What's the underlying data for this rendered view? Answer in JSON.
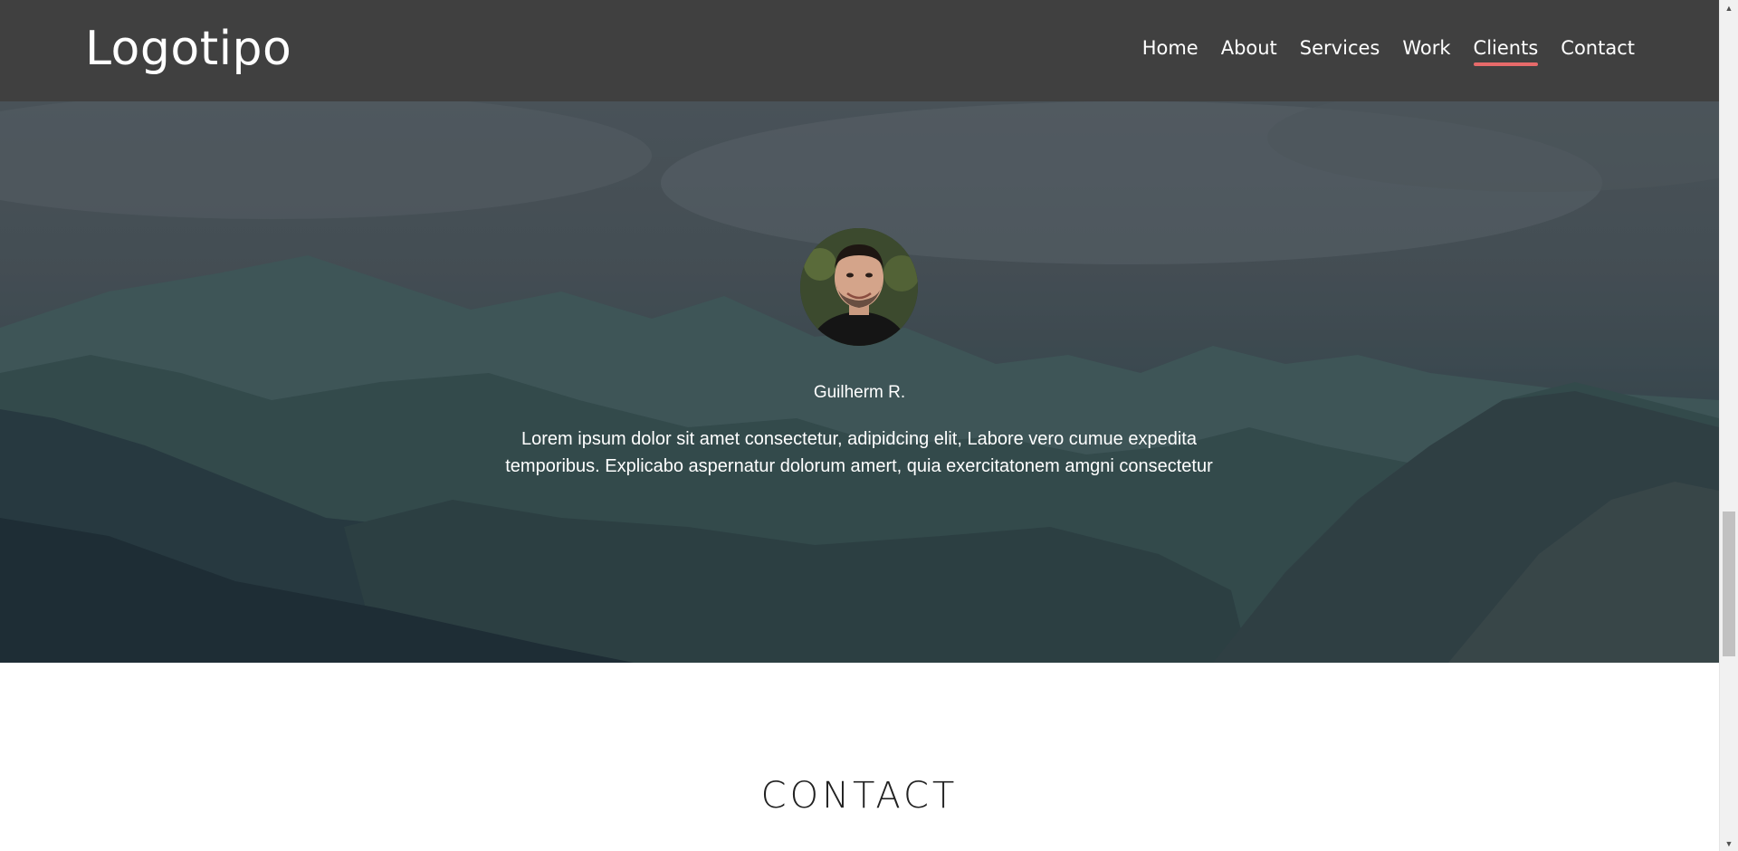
{
  "header": {
    "logo": "Logotipo",
    "nav": [
      {
        "label": "Home",
        "active": false
      },
      {
        "label": "About",
        "active": false
      },
      {
        "label": "Services",
        "active": false
      },
      {
        "label": "Work",
        "active": false
      },
      {
        "label": "Clients",
        "active": true
      },
      {
        "label": "Contact",
        "active": false
      }
    ]
  },
  "testimonial": {
    "author": "Guilherm R.",
    "quote_line1": "Lorem ipsum dolor sit amet consectetur, adipidcing elit, Labore vero cumue expedita",
    "quote_line2": "temporibus. Explicabo aspernatur dolorum amert, quia exercitatonem amgni consectetur"
  },
  "contact": {
    "title": "CONTACT"
  },
  "colors": {
    "header_bg": "#404040",
    "accent": "#e76a6a",
    "text_light": "#ffffff",
    "text_dark": "#222222"
  },
  "icons": {
    "scroll_up": "triangle-up-icon",
    "scroll_down": "triangle-down-icon"
  },
  "scroll": {
    "position_fraction": 0.62
  }
}
